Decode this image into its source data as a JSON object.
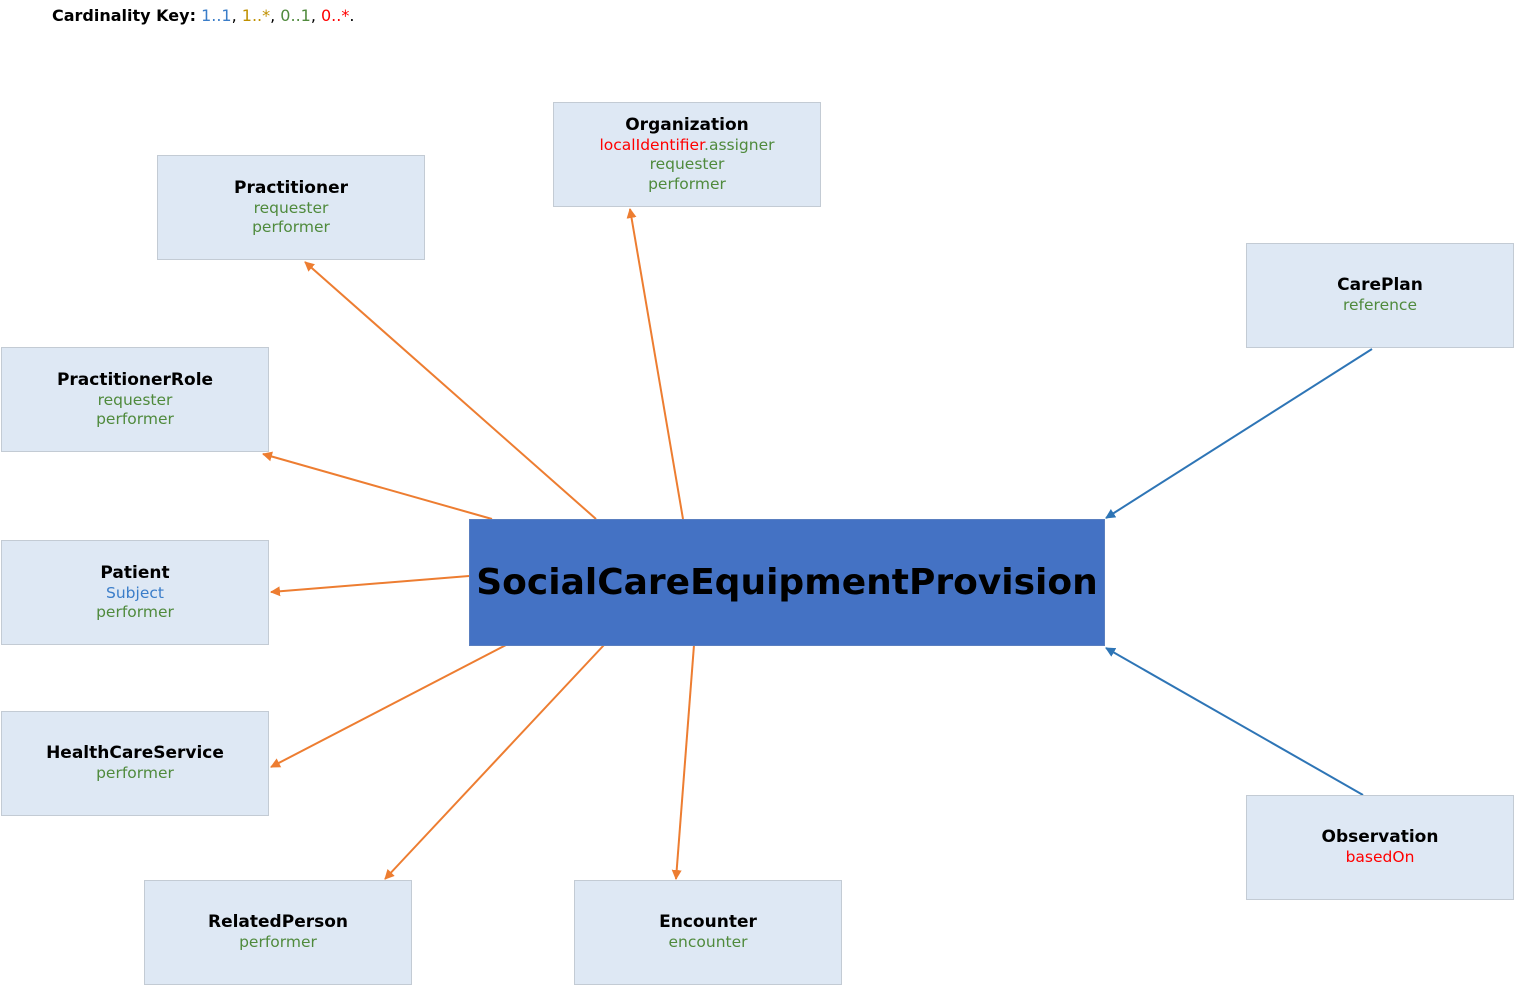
{
  "key": {
    "label": "Cardinality Key:",
    "items": [
      {
        "text": "1..1",
        "color": "#3a7dc9"
      },
      {
        "text": "1..*",
        "color": "#c09000"
      },
      {
        "text": "0..1",
        "color": "#4f8a3c"
      },
      {
        "text": "0..*",
        "color": "#ff0000"
      }
    ]
  },
  "colors": {
    "orange_arrow": "#ed7d31",
    "blue_arrow": "#2e75b6",
    "main_fill": "#4472c4",
    "box_fill": "#dee8f4"
  },
  "main": {
    "title": "SocialCareEquipmentProvision"
  },
  "boxes": [
    {
      "id": "practitioner",
      "title": "Practitioner",
      "lines": [
        [
          {
            "text": "requester",
            "color": "#4f8a3c"
          }
        ],
        [
          {
            "text": "performer",
            "color": "#4f8a3c"
          }
        ]
      ]
    },
    {
      "id": "organization",
      "title": "Organization",
      "lines": [
        [
          {
            "text": "localIdentifier",
            "color": "#ff0000"
          },
          {
            "text": ".assigner",
            "color": "#4f8a3c"
          }
        ],
        [
          {
            "text": "requester",
            "color": "#4f8a3c"
          }
        ],
        [
          {
            "text": "performer",
            "color": "#4f8a3c"
          }
        ]
      ]
    },
    {
      "id": "careplan",
      "title": "CarePlan",
      "lines": [
        [
          {
            "text": "reference",
            "color": "#4f8a3c"
          }
        ]
      ]
    },
    {
      "id": "practitionerrole",
      "title": "PractitionerRole",
      "lines": [
        [
          {
            "text": "requester",
            "color": "#4f8a3c"
          }
        ],
        [
          {
            "text": "performer",
            "color": "#4f8a3c"
          }
        ]
      ]
    },
    {
      "id": "patient",
      "title": "Patient",
      "lines": [
        [
          {
            "text": "Subject",
            "color": "#3a7dc9"
          }
        ],
        [
          {
            "text": "performer",
            "color": "#4f8a3c"
          }
        ]
      ]
    },
    {
      "id": "healthcareservice",
      "title": "HealthCareService",
      "lines": [
        [
          {
            "text": "performer",
            "color": "#4f8a3c"
          }
        ]
      ]
    },
    {
      "id": "relatedperson",
      "title": "RelatedPerson",
      "lines": [
        [
          {
            "text": "performer",
            "color": "#4f8a3c"
          }
        ]
      ]
    },
    {
      "id": "encounter",
      "title": "Encounter",
      "lines": [
        [
          {
            "text": "encounter",
            "color": "#4f8a3c"
          }
        ]
      ]
    },
    {
      "id": "observation",
      "title": "Observation",
      "lines": [
        [
          {
            "text": "basedOn",
            "color": "#ff0000"
          }
        ]
      ]
    }
  ]
}
